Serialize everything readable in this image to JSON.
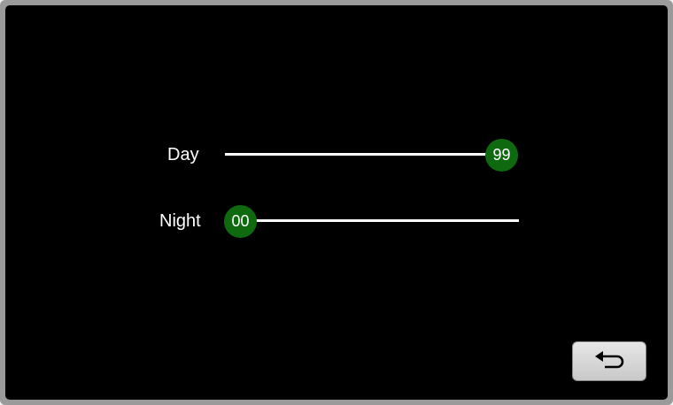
{
  "sliders": {
    "day": {
      "label": "Day",
      "value": "99"
    },
    "night": {
      "label": "Night",
      "value": "00"
    }
  },
  "back_button": {
    "icon": "return-arrow-icon"
  }
}
